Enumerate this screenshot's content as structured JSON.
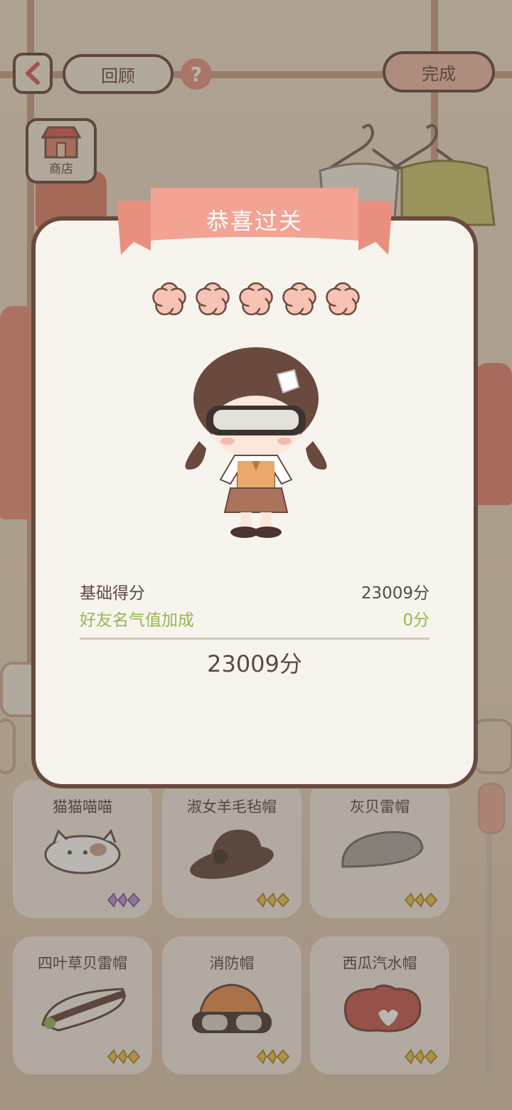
{
  "topbar": {
    "back_icon": "chevron-left-icon",
    "review_label": "回顾",
    "help_label": "?",
    "done_label": "完成",
    "shop_label": "商店"
  },
  "items": [
    {
      "name": "猫猫喵喵",
      "rarity": "purple"
    },
    {
      "name": "淑女羊毛毡帽",
      "rarity": "gold"
    },
    {
      "name": "灰贝雷帽",
      "rarity": "gold"
    },
    {
      "name": "四叶草贝雷帽",
      "rarity": "gold"
    },
    {
      "name": "消防帽",
      "rarity": "gold"
    },
    {
      "name": "西瓜汽水帽",
      "rarity": "gold"
    }
  ],
  "dialog": {
    "title": "恭喜过关",
    "stars_earned": 5,
    "stars_total": 5,
    "base_label": "基础得分",
    "base_value": "23009分",
    "bonus_label": "好友名气值加成",
    "bonus_value": "0分",
    "total_value": "23009分"
  },
  "colors": {
    "ribbon": "#f2a394",
    "star": "#f6c3b4",
    "bonus_text": "#9ab653",
    "purple_rarity": "#b78ed6",
    "gold_rarity": "#e9c34f"
  }
}
